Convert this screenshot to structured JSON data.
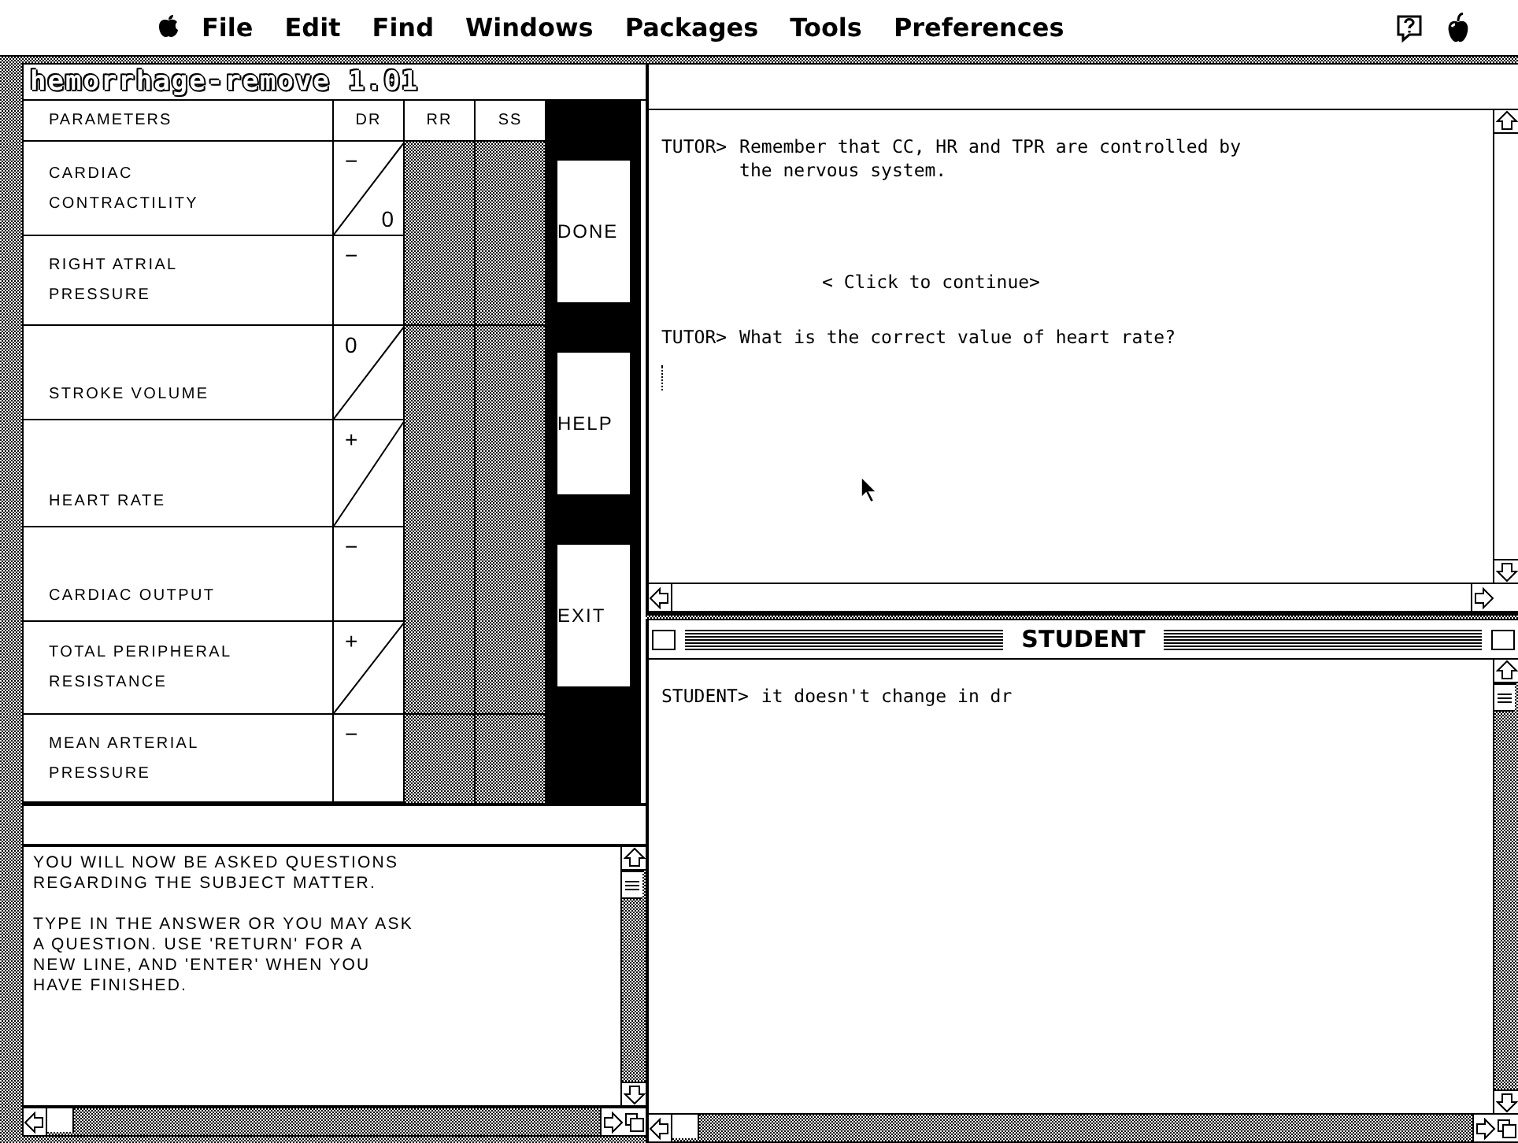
{
  "menu_bar": {
    "items": [
      "File",
      "Edit",
      "Find",
      "Windows",
      "Packages",
      "Tools",
      "Preferences"
    ]
  },
  "parameters_window": {
    "title": "hemorrhage-remove 1.01",
    "columns": [
      "PARAMETERS",
      "DR",
      "RR",
      "SS"
    ],
    "rows": [
      {
        "name": "CARDIAC\nCONTRACTILITY",
        "dr": "−",
        "split": true,
        "correction": "0"
      },
      {
        "name": "RIGHT ATRIAL\nPRESSURE",
        "dr": "−",
        "split": false
      },
      {
        "name": "STROKE VOLUME",
        "dr": "0",
        "split": true
      },
      {
        "name": "HEART RATE",
        "dr": "+",
        "split": true
      },
      {
        "name": "CARDIAC OUTPUT",
        "dr": "−",
        "split": false
      },
      {
        "name": "TOTAL PERIPHERAL\nRESISTANCE",
        "dr": "+",
        "split": true
      },
      {
        "name": "MEAN ARTERIAL\nPRESSURE",
        "dr": "−",
        "split": false
      }
    ],
    "buttons": [
      "DONE",
      "HELP",
      "EXIT"
    ],
    "instructions": [
      "YOU WILL NOW BE ASKED QUESTIONS\nREGARDING THE SUBJECT MATTER.",
      "TYPE IN THE ANSWER OR YOU MAY ASK\nA QUESTION.  USE 'RETURN' FOR A\nNEW LINE, AND 'ENTER' WHEN YOU\nHAVE FINISHED."
    ]
  },
  "tutor_window": {
    "messages": [
      {
        "kind": "tutor",
        "prefix": "TUTOR>",
        "text": "Remember that CC, HR and TPR are controlled by\nthe nervous system."
      },
      {
        "kind": "prompt",
        "text": "< Click to continue>"
      },
      {
        "kind": "tutor",
        "prefix": "TUTOR>",
        "text": "What is the correct value of heart rate?"
      }
    ]
  },
  "student_window": {
    "title": "STUDENT",
    "messages": [
      {
        "kind": "student",
        "prefix": "STUDENT>",
        "text": "it doesn't change in dr"
      }
    ]
  }
}
